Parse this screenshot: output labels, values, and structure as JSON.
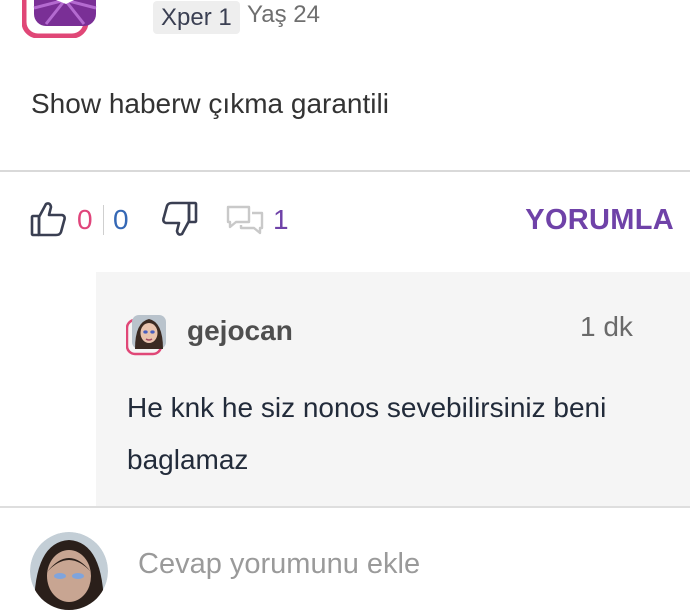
{
  "author": {
    "xper_level": "Xper 1",
    "age": "Yaş 24"
  },
  "post": {
    "text": "Show haberw çıkma garantili"
  },
  "actions": {
    "like_count": "0",
    "dislike_count": "0",
    "comment_count": "1",
    "reply_label": "YORUMLA"
  },
  "reply": {
    "username": "gejocan",
    "time": "1 dk",
    "text": "He knk he siz nonos sevebilirsiniz beni baglamaz"
  },
  "composer": {
    "placeholder": "Cevap yorumunu ekle"
  },
  "colors": {
    "accent_purple": "#6f42a8",
    "like_pink": "#e0457b",
    "dislike_blue": "#3568b5",
    "avatar_ring": "#e04777"
  },
  "icons": {
    "like": "thumbs-up-icon",
    "dislike": "thumbs-down-icon",
    "comment": "speech-bubbles-icon"
  }
}
